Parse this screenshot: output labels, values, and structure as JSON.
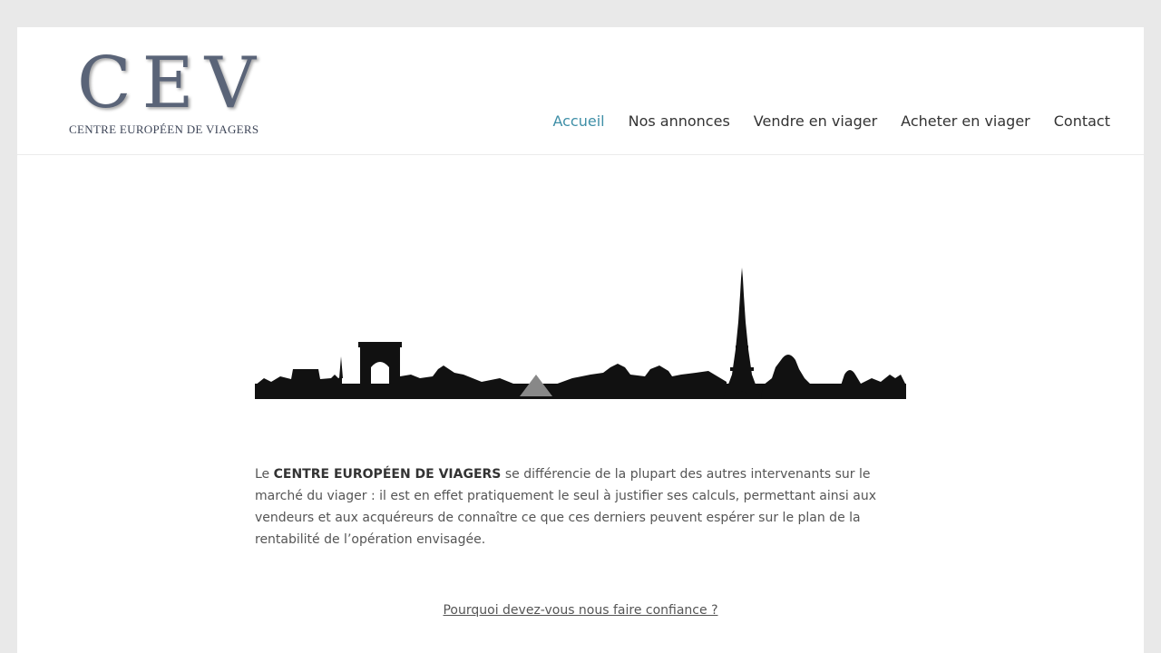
{
  "brand": {
    "logo_mark": "CEV",
    "tagline": "CENTRE EUROPÉEN DE VIAGERS"
  },
  "nav": {
    "items": [
      {
        "label": "Accueil",
        "active": true
      },
      {
        "label": "Nos annonces",
        "active": false
      },
      {
        "label": "Vendre en viager",
        "active": false
      },
      {
        "label": "Acheter en viager",
        "active": false
      },
      {
        "label": "Contact",
        "active": false
      }
    ]
  },
  "content": {
    "intro_prefix": "Le ",
    "intro_bold": "CENTRE EUROPÉEN DE VIAGERS",
    "intro_rest": " se différencie de la plupart des autres intervenants sur le marché du viager : il est en effet pratiquement le seul à justifier ses calculs, permettant ainsi aux vendeurs et aux acquéreurs de connaître ce que ces derniers peuvent espérer sur le plan de la rentabilité de l’opération envisagée.",
    "trust_link": "Pourquoi devez-vous nous faire confiance ?"
  },
  "colors": {
    "accent": "#3f8fa7",
    "logo": "#5a6478",
    "background": "#e9e9e9"
  },
  "images": {
    "skyline": "paris-skyline-silhouette"
  }
}
